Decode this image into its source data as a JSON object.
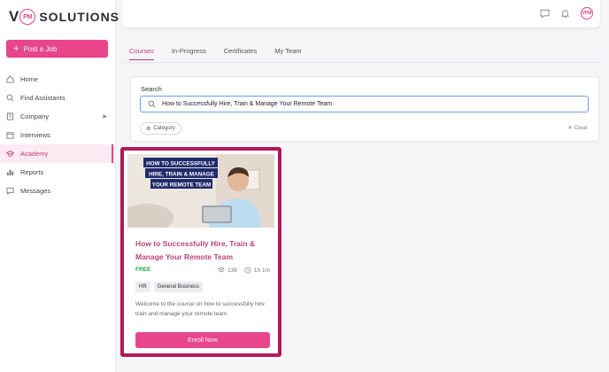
{
  "brand": {
    "mark": "V",
    "badge": "PM",
    "name": "SOLUTIONS"
  },
  "sidebar": {
    "post_button": "Post a Job",
    "items": [
      {
        "label": "Home",
        "icon": "home-icon"
      },
      {
        "label": "Find Assistants",
        "icon": "search-icon"
      },
      {
        "label": "Company",
        "icon": "building-icon"
      },
      {
        "label": "Interviews",
        "icon": "calendar-icon"
      },
      {
        "label": "Academy",
        "icon": "graduation-icon"
      },
      {
        "label": "Reports",
        "icon": "bar-chart-icon"
      },
      {
        "label": "Messages",
        "icon": "message-icon"
      }
    ]
  },
  "header": {
    "avatar_initials": "VPM"
  },
  "tabs": [
    {
      "label": "Courses"
    },
    {
      "label": "In-Progress"
    },
    {
      "label": "Certificates"
    },
    {
      "label": "My Team"
    }
  ],
  "search": {
    "label": "Search",
    "value": "How to Successfully Hire, Train & Manage Your Remote Team",
    "filter_chip": "Category",
    "clear_label": "Clear"
  },
  "course": {
    "thumb_lines": [
      "HOW TO SUCCESSFULLY",
      "HIRE, TRAIN & MANAGE",
      "YOUR REMOTE TEAM"
    ],
    "title": "How to Successfully Hire, Train & Manage Your Remote Team",
    "price": "FREE",
    "lessons": "136",
    "duration": "1h 1m",
    "tags": [
      "HR",
      "General Business"
    ],
    "description": "Welcome to the course on how to successfully hire train and manage your remote team",
    "button": "Enroll Now"
  },
  "colors": {
    "accent": "#e8458a",
    "highlight": "#b3185b",
    "free": "#27a54a"
  }
}
